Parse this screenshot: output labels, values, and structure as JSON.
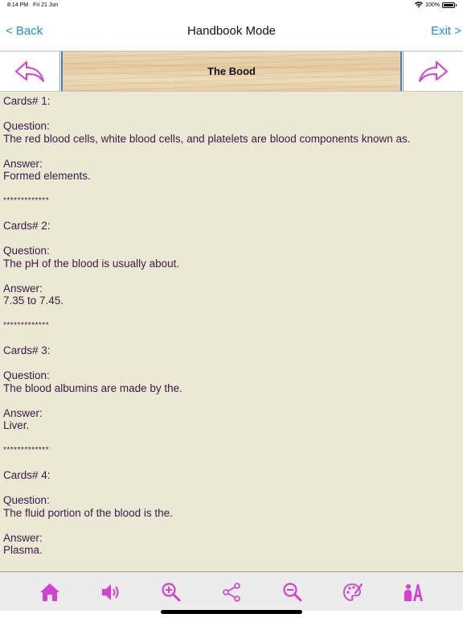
{
  "status_bar": {
    "time": "8:14 PM",
    "date": "Fri 21 Jun",
    "battery": "100%"
  },
  "nav": {
    "back_label": "< Back",
    "title": "Handbook Mode",
    "exit_label": "Exit >"
  },
  "header": {
    "section_title": "The Bood"
  },
  "cards": [
    {
      "heading": "Cards# 1:",
      "question_label": "Question:",
      "question": "The red blood cells, white blood cells, and platelets are blood components known as.",
      "answer_label": "Answer:",
      "answer": "Formed elements.",
      "separator": "*************"
    },
    {
      "heading": "Cards# 2:",
      "question_label": "Question:",
      "question": "The pH of the blood is usually about.",
      "answer_label": "Answer:",
      "answer": "7.35 to 7.45.",
      "separator": "*************"
    },
    {
      "heading": "Cards# 3:",
      "question_label": "Question:",
      "question": "The blood albumins are made by the.",
      "answer_label": "Answer:",
      "answer": "Liver.",
      "separator": "*************"
    },
    {
      "heading": "Cards# 4:",
      "question_label": "Question:",
      "question": "The fluid portion of the blood is the.",
      "answer_label": "Answer:",
      "answer": "Plasma.",
      "separator": "*************"
    }
  ],
  "toolbar": {
    "icons": [
      "home-icon",
      "speaker-icon",
      "zoom-in-icon",
      "share-icon",
      "zoom-out-icon",
      "palette-icon",
      "text-style-icon"
    ]
  },
  "colors": {
    "accent": "#1a8cf0",
    "icon": "#d63fd6",
    "content_bg": "#ebe9d4",
    "content_text": "#3d1a4a"
  }
}
